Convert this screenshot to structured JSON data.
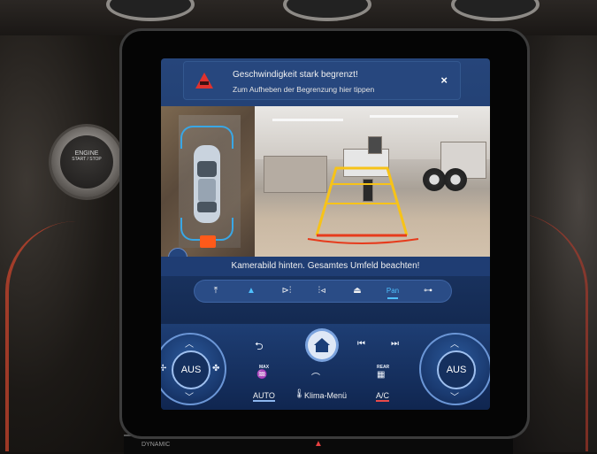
{
  "notification": {
    "title": "Geschwindigkeit stark begrenzt!",
    "subtitle": "Zum Aufheben der Begrenzung hier tippen",
    "close_symbol": "×",
    "icon": "speed-limit-warning-icon",
    "accent": "#e0322e"
  },
  "camera": {
    "banner": "Kamerabild hinten. Gesamtes Umfeld beachten!",
    "guide_colors": {
      "distance": "#f7c318",
      "stop": "#e63b1c",
      "bracket": "#39a7e6"
    },
    "modes": [
      {
        "icon": "front-camera-icon",
        "glyph": "⤒"
      },
      {
        "icon": "driver-view-icon",
        "glyph": "▲"
      },
      {
        "icon": "side-left-camera-icon",
        "glyph": "⊳⫶"
      },
      {
        "icon": "side-right-camera-icon",
        "glyph": "⫶⊲"
      },
      {
        "icon": "car-top-view-icon",
        "glyph": "⏏"
      },
      {
        "label": "Pan",
        "active": true
      },
      {
        "icon": "trailer-view-icon",
        "glyph": "⊶"
      }
    ]
  },
  "controls": {
    "left_dial": {
      "label": "AUS"
    },
    "right_dial": {
      "label": "AUS"
    },
    "back_symbol": "⮌",
    "prev_symbol": "⏮",
    "next_symbol": "⏭",
    "fan_low_symbol": "✢",
    "fan_high_symbol": "✤",
    "max_defrost_label": "MAX",
    "rear_defrost_label": "REAR",
    "auto_label": "AUTO",
    "klima_label": "Klima-Menü",
    "ac_label": "A/C"
  },
  "hardware": {
    "engine_button_line1": "ENGINE",
    "engine_button_line2": "START / STOP",
    "bottom_strip_label": "DYNAMIC"
  }
}
